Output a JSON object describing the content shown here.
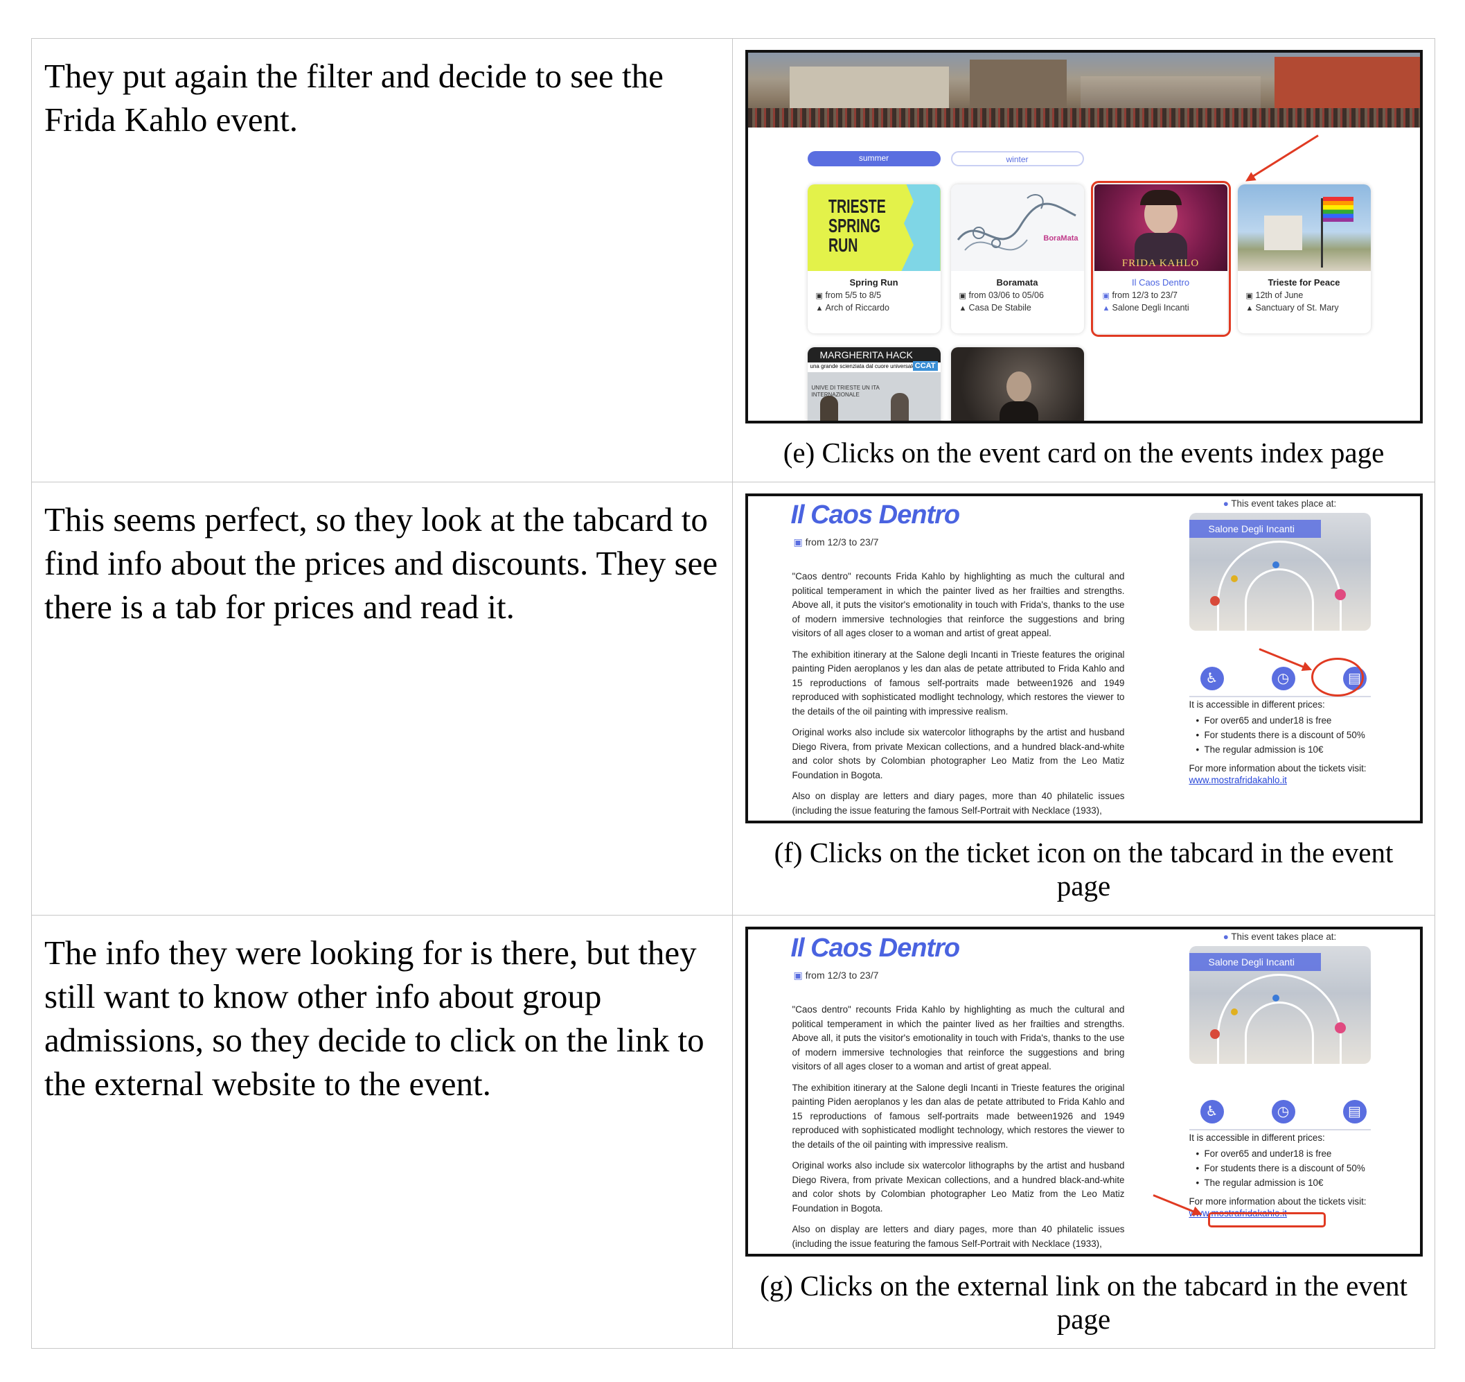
{
  "rows": [
    {
      "narrative": "They put again the filter and decide to see the Frida Kahlo event.",
      "caption": "(e) Clicks on the event card on the events index page"
    },
    {
      "narrative": "This seems perfect, so they look at the tabcard to find info about the prices and discounts. They see there is a tab for prices and read it.",
      "caption": "(f) Clicks on the ticket icon on the tabcard in the event page"
    },
    {
      "narrative": "The info they were looking for is there, but they still want to know other info about group admissions, so they decide to click on the link to the external website to the event.",
      "caption": "(g) Clicks on the external link on the tabcard in the event page"
    }
  ],
  "index_page": {
    "filters": [
      "summer",
      "winter"
    ],
    "cards": [
      {
        "title": "Spring Run",
        "date": "from 5/5 to 8/5",
        "place": "Arch of Riccardo",
        "img_text": "TRIESTE SPRING RUN"
      },
      {
        "title": "Boramata",
        "date": "from 03/06 to 05/06",
        "place": "Casa De Stabile",
        "img_text": "BoraMata"
      },
      {
        "title": "Il Caos Dentro",
        "date": "from 12/3 to 23/7",
        "place": "Salone Degli Incanti",
        "img_text": "FRIDA KAHLO"
      },
      {
        "title": "Trieste for Peace",
        "date": "12th of June",
        "place": "Sanctuary of St. Mary",
        "img_text": ""
      }
    ],
    "second_row": {
      "card1_title": "MARGHERITA HACK",
      "card1_sub": "una grande scienziata dal cuore universale",
      "card1_logo": "CCAT",
      "card1_banner": "UNIVE DI TRIESTE UN ITA INTERNAZIONALE"
    }
  },
  "event_page": {
    "title": "Il Caos Dentro",
    "date": "from 12/3 to 23/7",
    "paragraphs": [
      "\"Caos dentro\" recounts Frida Kahlo by highlighting as much the cultural and political temperament in which the painter lived as her frailties and strengths. Above all, it puts the visitor's emotionality in touch with Frida's, thanks to the use of modern immersive technologies that reinforce the suggestions and bring visitors of all ages closer to a woman and artist of great appeal.",
      "The exhibition itinerary at the Salone degli Incanti in Trieste features the original painting Piden aeroplanos y les dan alas de petate attributed to Frida Kahlo and 15 reproductions of famous self-portraits made between1926 and 1949 reproduced with sophisticated modlight technology, which restores the viewer to the details of the oil painting with impressive realism.",
      "Original works also include six watercolor lithographs by the artist and husband Diego Rivera, from private Mexican collections, and a hundred black-and-white and color shots by Colombian photographer Leo Matiz from the Leo Matiz Foundation in Bogota.",
      "Also on display are letters and diary pages, more than 40 philatelic issues (including the issue featuring the famous Self-Portrait with Necklace (1933),"
    ],
    "where_label": "This event takes place at:",
    "venue": "Salone Degli Incanti",
    "price_intro": "It is accessible in different prices:",
    "prices": [
      "For over65 and under18 is free",
      "For students there is a discount of 50%",
      "The regular admission is 10€"
    ],
    "more_info": "For more information about the tickets visit:",
    "link": "www.mostrafridakahlo.it"
  },
  "colors": {
    "accent": "#5a6ee0",
    "highlight": "#e03a22"
  }
}
